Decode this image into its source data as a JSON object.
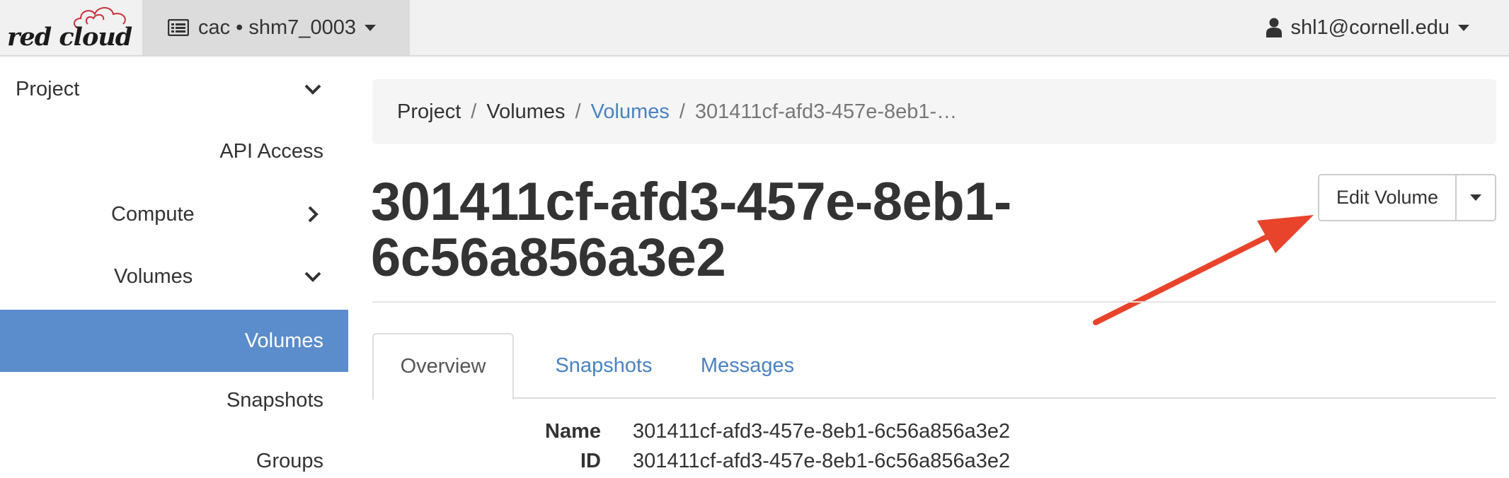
{
  "navbar": {
    "brand_text": "red cloud",
    "project_switcher": "cac • shm7_0003",
    "user": "shl1@cornell.edu"
  },
  "sidebar": {
    "items": [
      {
        "label": "Project",
        "chevron": "chevron-down-icon"
      },
      {
        "label": "API Access"
      },
      {
        "label": "Compute",
        "chevron": "chevron-right-icon"
      },
      {
        "label": "Volumes",
        "chevron": "chevron-down-icon"
      },
      {
        "label": "Volumes",
        "active": true
      },
      {
        "label": "Snapshots"
      },
      {
        "label": "Groups"
      }
    ],
    "active_color": "#5b8ccb"
  },
  "breadcrumb": {
    "items": [
      "Project",
      "Volumes",
      "Volumes",
      "301411cf-afd3-457e-8eb1-…"
    ],
    "separator": "/"
  },
  "page": {
    "title_line1": "301411cf-afd3-457e-8eb1-",
    "title_line2": "6c56a856a3e2"
  },
  "actions": {
    "edit_volume": "Edit Volume"
  },
  "tabs": [
    "Overview",
    "Snapshots",
    "Messages"
  ],
  "details": [
    {
      "label": "Name",
      "value": "301411cf-afd3-457e-8eb1-6c56a856a3e2"
    },
    {
      "label": "ID",
      "value": "301411cf-afd3-457e-8eb1-6c56a856a3e2"
    }
  ],
  "annotation": {
    "arrow_color": "#e8432b"
  },
  "link_color": "#4a82c2"
}
